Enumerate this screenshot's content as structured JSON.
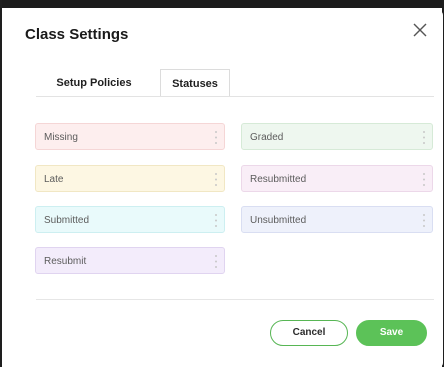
{
  "dialog": {
    "title": "Class Settings",
    "close_icon": "close-icon"
  },
  "tabs": [
    {
      "label": "Setup Policies",
      "active": false
    },
    {
      "label": "Statuses",
      "active": true
    }
  ],
  "statuses": [
    {
      "label": "Missing",
      "color": "#fdeeee",
      "border": "#f5d6d6"
    },
    {
      "label": "Graded",
      "color": "#eef7ef",
      "border": "#d6ead7"
    },
    {
      "label": "Late",
      "color": "#fdf7e3",
      "border": "#f1e7c4"
    },
    {
      "label": "Resubmitted",
      "color": "#f9eef7",
      "border": "#ecd8e9"
    },
    {
      "label": "Submitted",
      "color": "#e9fafb",
      "border": "#cdeff1"
    },
    {
      "label": "Unsubmitted",
      "color": "#eef1fb",
      "border": "#d9def2"
    },
    {
      "label": "Resubmit",
      "color": "#f3ecfb",
      "border": "#e0d4f0"
    }
  ],
  "drag_handle_icon": "drag-handle-icon",
  "buttons": {
    "cancel_label": "Cancel",
    "save_label": "Save",
    "save_color": "#5cc258",
    "cancel_border_color": "#57b654"
  }
}
